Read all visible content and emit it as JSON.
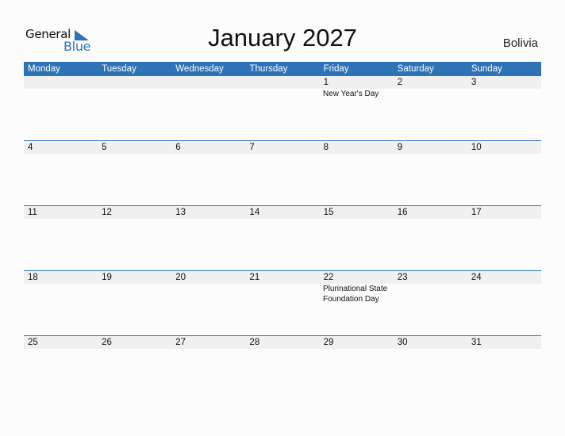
{
  "logo": {
    "word1": "General",
    "word2": "Blue"
  },
  "title": "January 2027",
  "country": "Bolivia",
  "colors": {
    "accent": "#2e72b8",
    "date_row_bg": "#f0f0f0"
  },
  "weekdays": [
    "Monday",
    "Tuesday",
    "Wednesday",
    "Thursday",
    "Friday",
    "Saturday",
    "Sunday"
  ],
  "weeks": [
    {
      "dates": [
        "",
        "",
        "",
        "",
        "1",
        "2",
        "3"
      ],
      "events": [
        "",
        "",
        "",
        "",
        "New Year's Day",
        "",
        ""
      ]
    },
    {
      "dates": [
        "4",
        "5",
        "6",
        "7",
        "8",
        "9",
        "10"
      ],
      "events": [
        "",
        "",
        "",
        "",
        "",
        "",
        ""
      ]
    },
    {
      "dates": [
        "11",
        "12",
        "13",
        "14",
        "15",
        "16",
        "17"
      ],
      "events": [
        "",
        "",
        "",
        "",
        "",
        "",
        ""
      ]
    },
    {
      "dates": [
        "18",
        "19",
        "20",
        "21",
        "22",
        "23",
        "24"
      ],
      "events": [
        "",
        "",
        "",
        "",
        "Plurinational State Foundation Day",
        "",
        ""
      ]
    },
    {
      "dates": [
        "25",
        "26",
        "27",
        "28",
        "29",
        "30",
        "31"
      ],
      "events": [
        "",
        "",
        "",
        "",
        "",
        "",
        ""
      ]
    }
  ]
}
